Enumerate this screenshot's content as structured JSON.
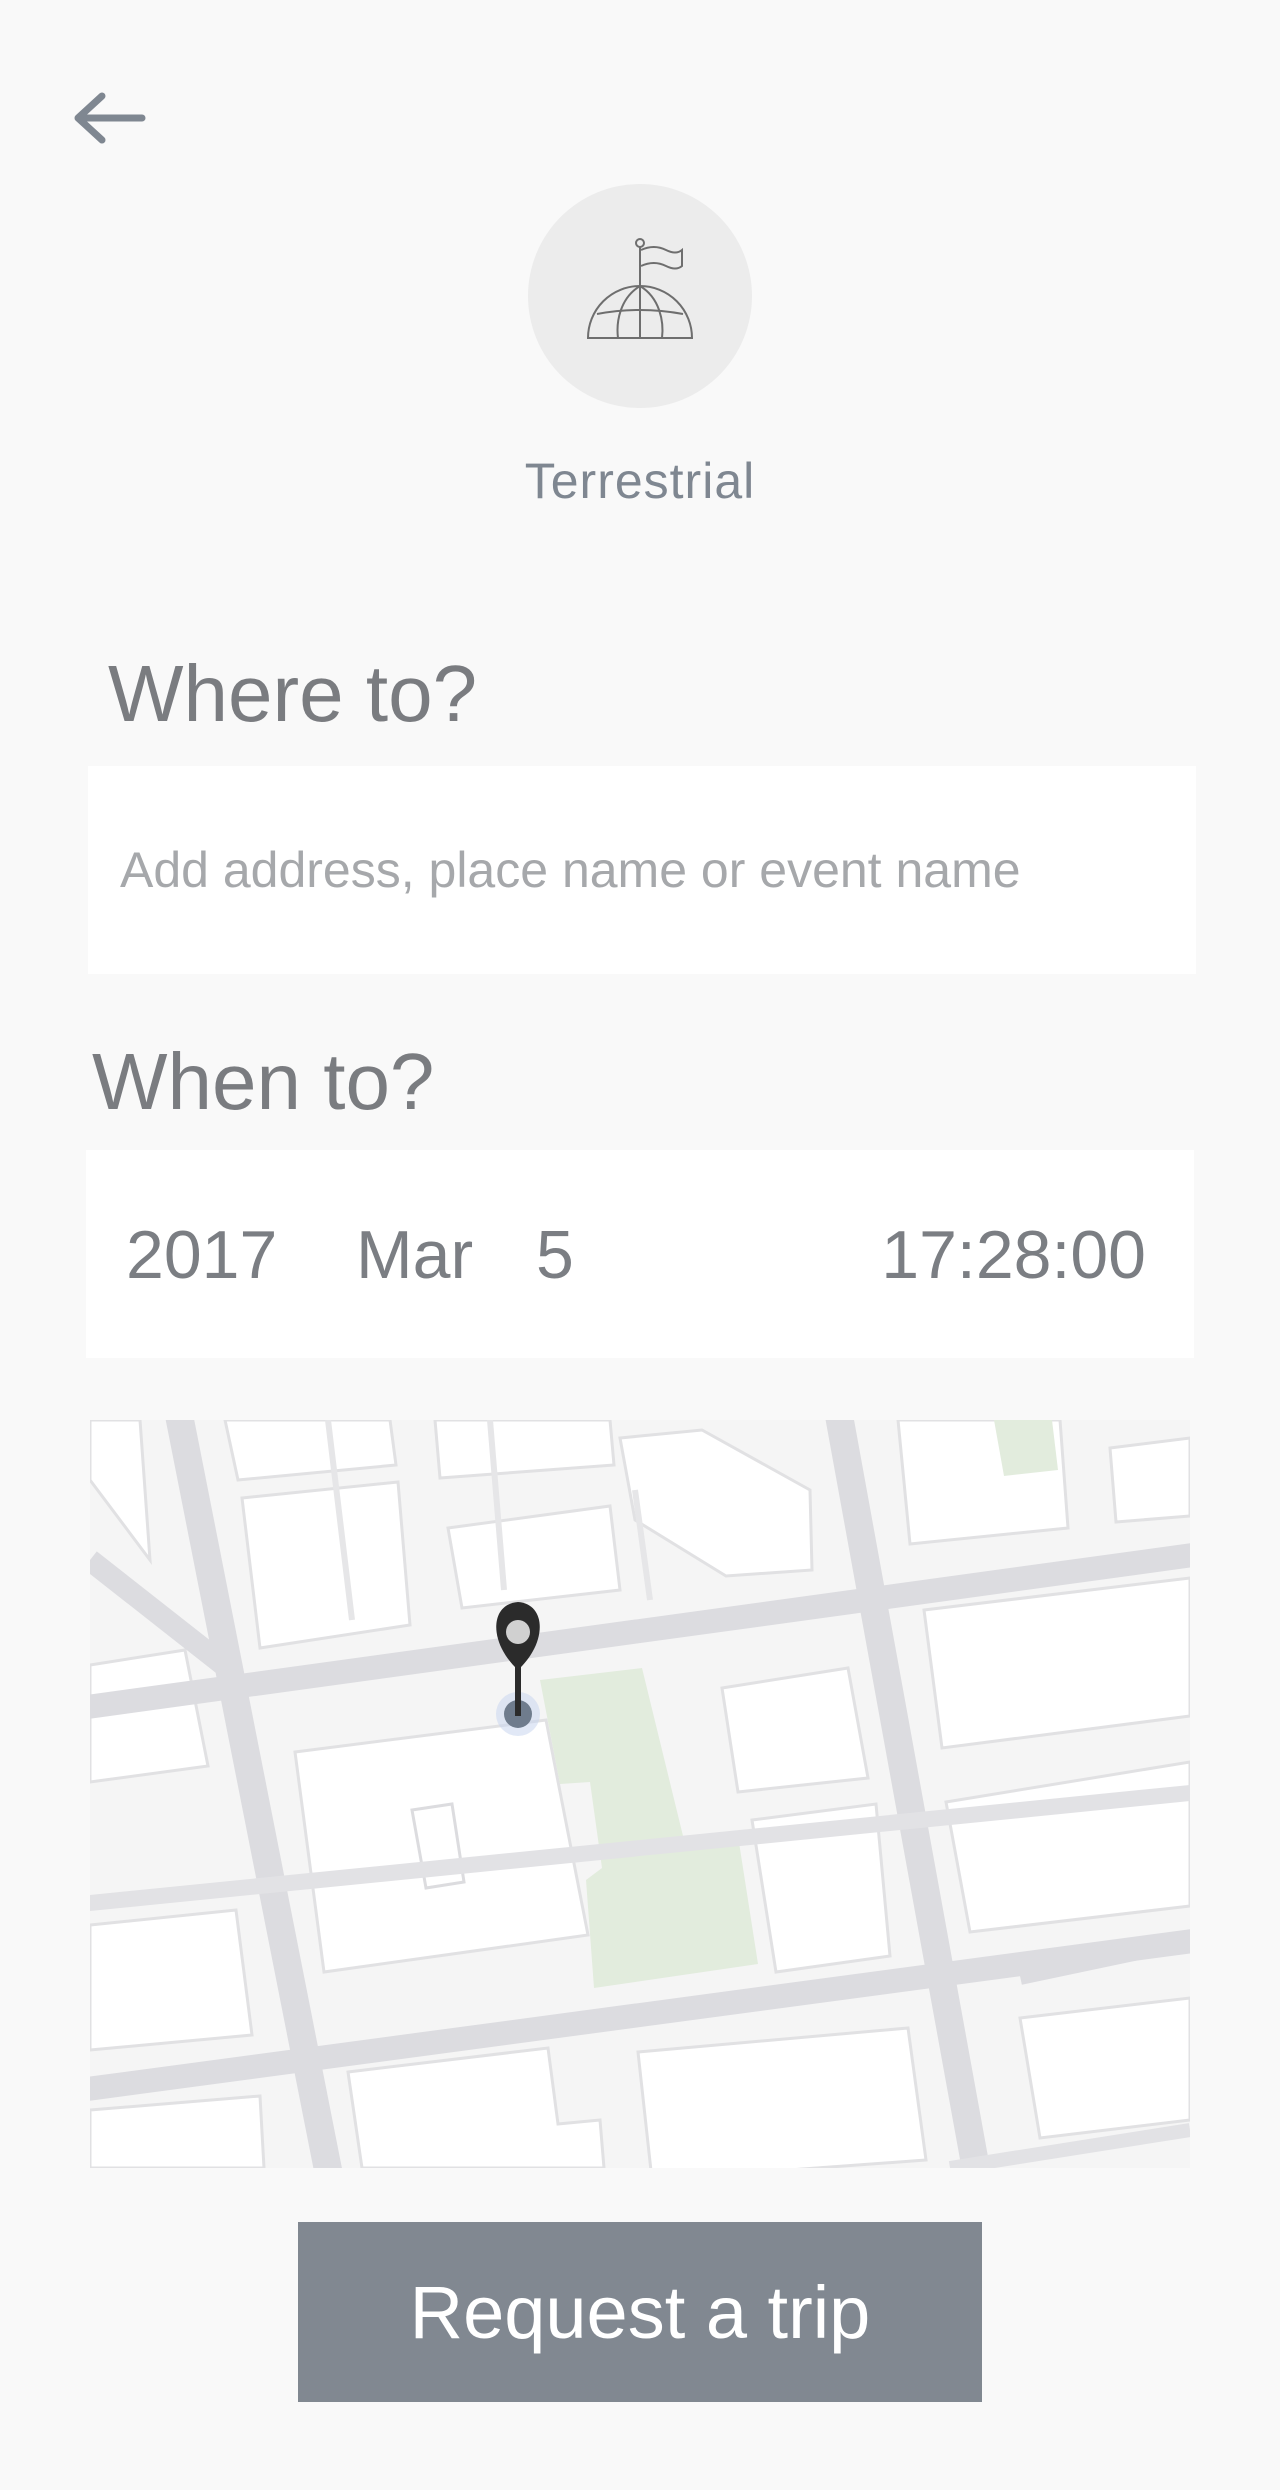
{
  "header": {
    "back_icon": "arrow-left-icon"
  },
  "mode": {
    "icon": "globe-flag-icon",
    "label": "Terrestrial"
  },
  "destination": {
    "title": "Where to?",
    "placeholder": "Add address, place name or event name",
    "value": ""
  },
  "datetime": {
    "title": "When to?",
    "year": "2017",
    "month": "Mar",
    "day": "5",
    "time": "17:28:00"
  },
  "map": {
    "marker_icon": "location-pin-icon"
  },
  "actions": {
    "request_label": "Request a trip"
  },
  "colors": {
    "background": "#f9f9f9",
    "button": "#818891",
    "text": "#7a7c80",
    "park": "#e2ecdd",
    "road": "#dcdce0"
  }
}
